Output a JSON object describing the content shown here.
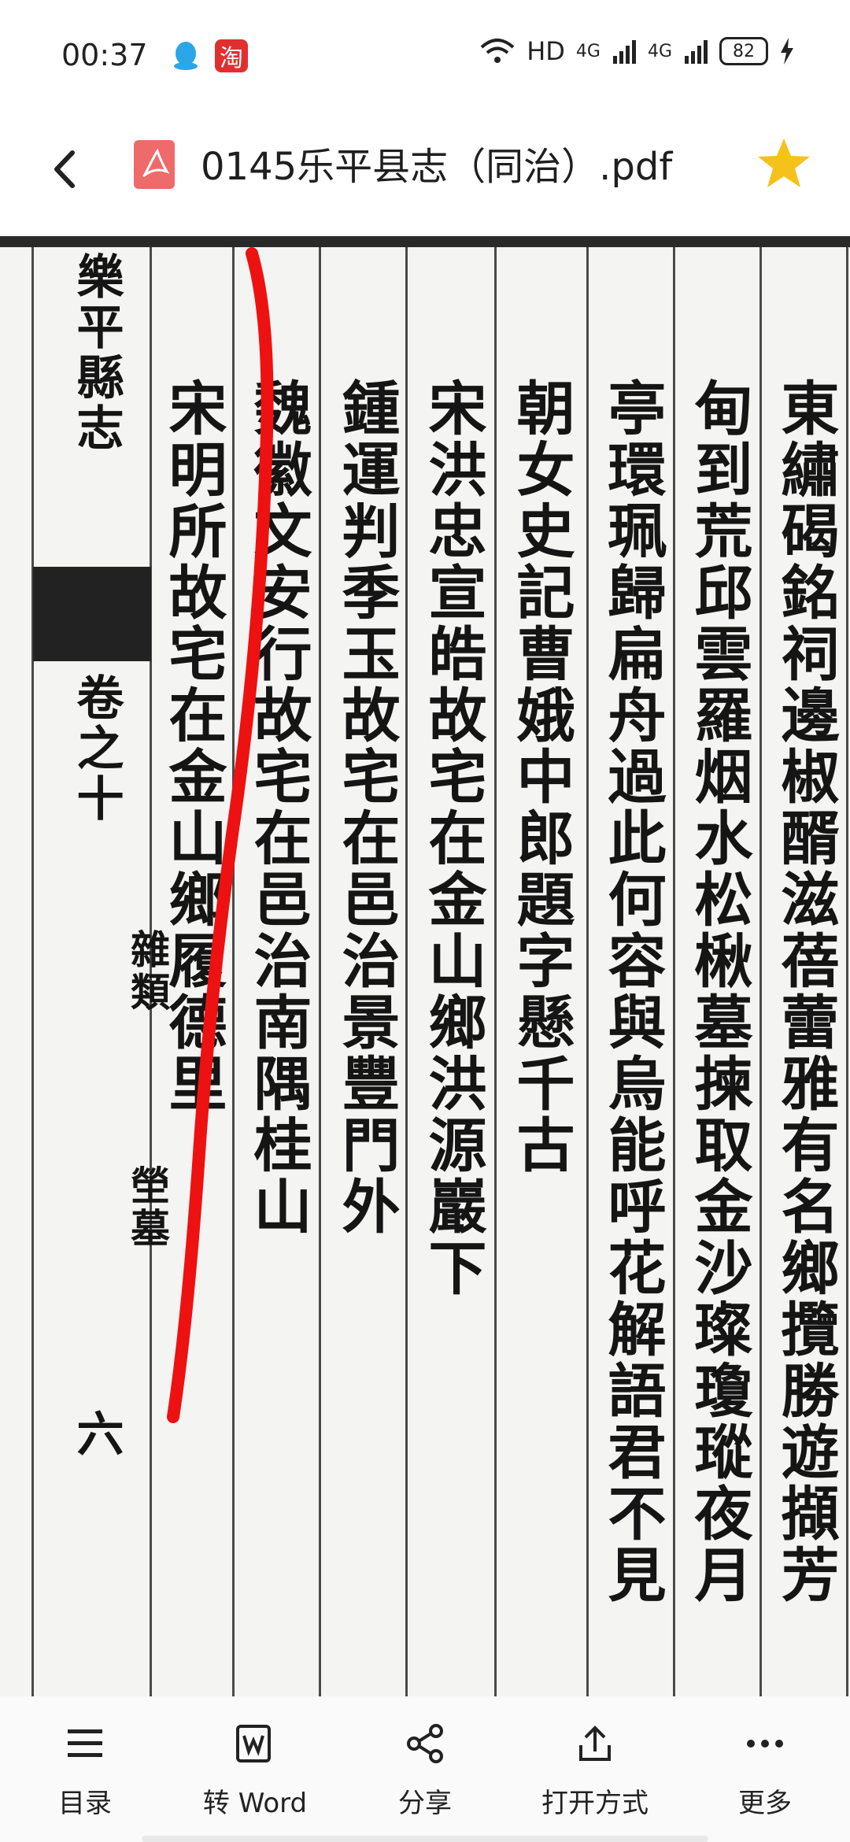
{
  "status_bar": {
    "time": "00:37",
    "taobao_glyph": "淘",
    "network_label": "HD",
    "signal1": "4G",
    "signal2": "4G",
    "battery": "82"
  },
  "header": {
    "title": "0145乐平县志（同治）.pdf",
    "star_color": "#f4c21b"
  },
  "page": {
    "columns": [
      "東繡碣銘祠邊椒醑滋蓓蕾雅有名鄉攬勝遊擷芳",
      "甸到荒邱雲羅烟水松楸墓揀取金沙璨瓊瑽夜月",
      "亭環珮歸扁舟過此何容與烏能呼花解語君不見",
      "朝女史記曹娥中郎題字懸千古",
      "宋洪忠宣皓故宅在金山鄉洪源巖下",
      "鍾運判季玉故宅在邑治景豐門外",
      "魏徽文安行故宅在邑治南隅桂山",
      "宋明所故宅在金山鄉履德里",
      "樂平縣志",
      "卷之十",
      "雜類",
      "塋墓",
      "六"
    ]
  },
  "toolbar": {
    "items": [
      {
        "label": "目录"
      },
      {
        "label": "转 Word"
      },
      {
        "label": "分享"
      },
      {
        "label": "打开方式"
      },
      {
        "label": "更多"
      }
    ]
  }
}
